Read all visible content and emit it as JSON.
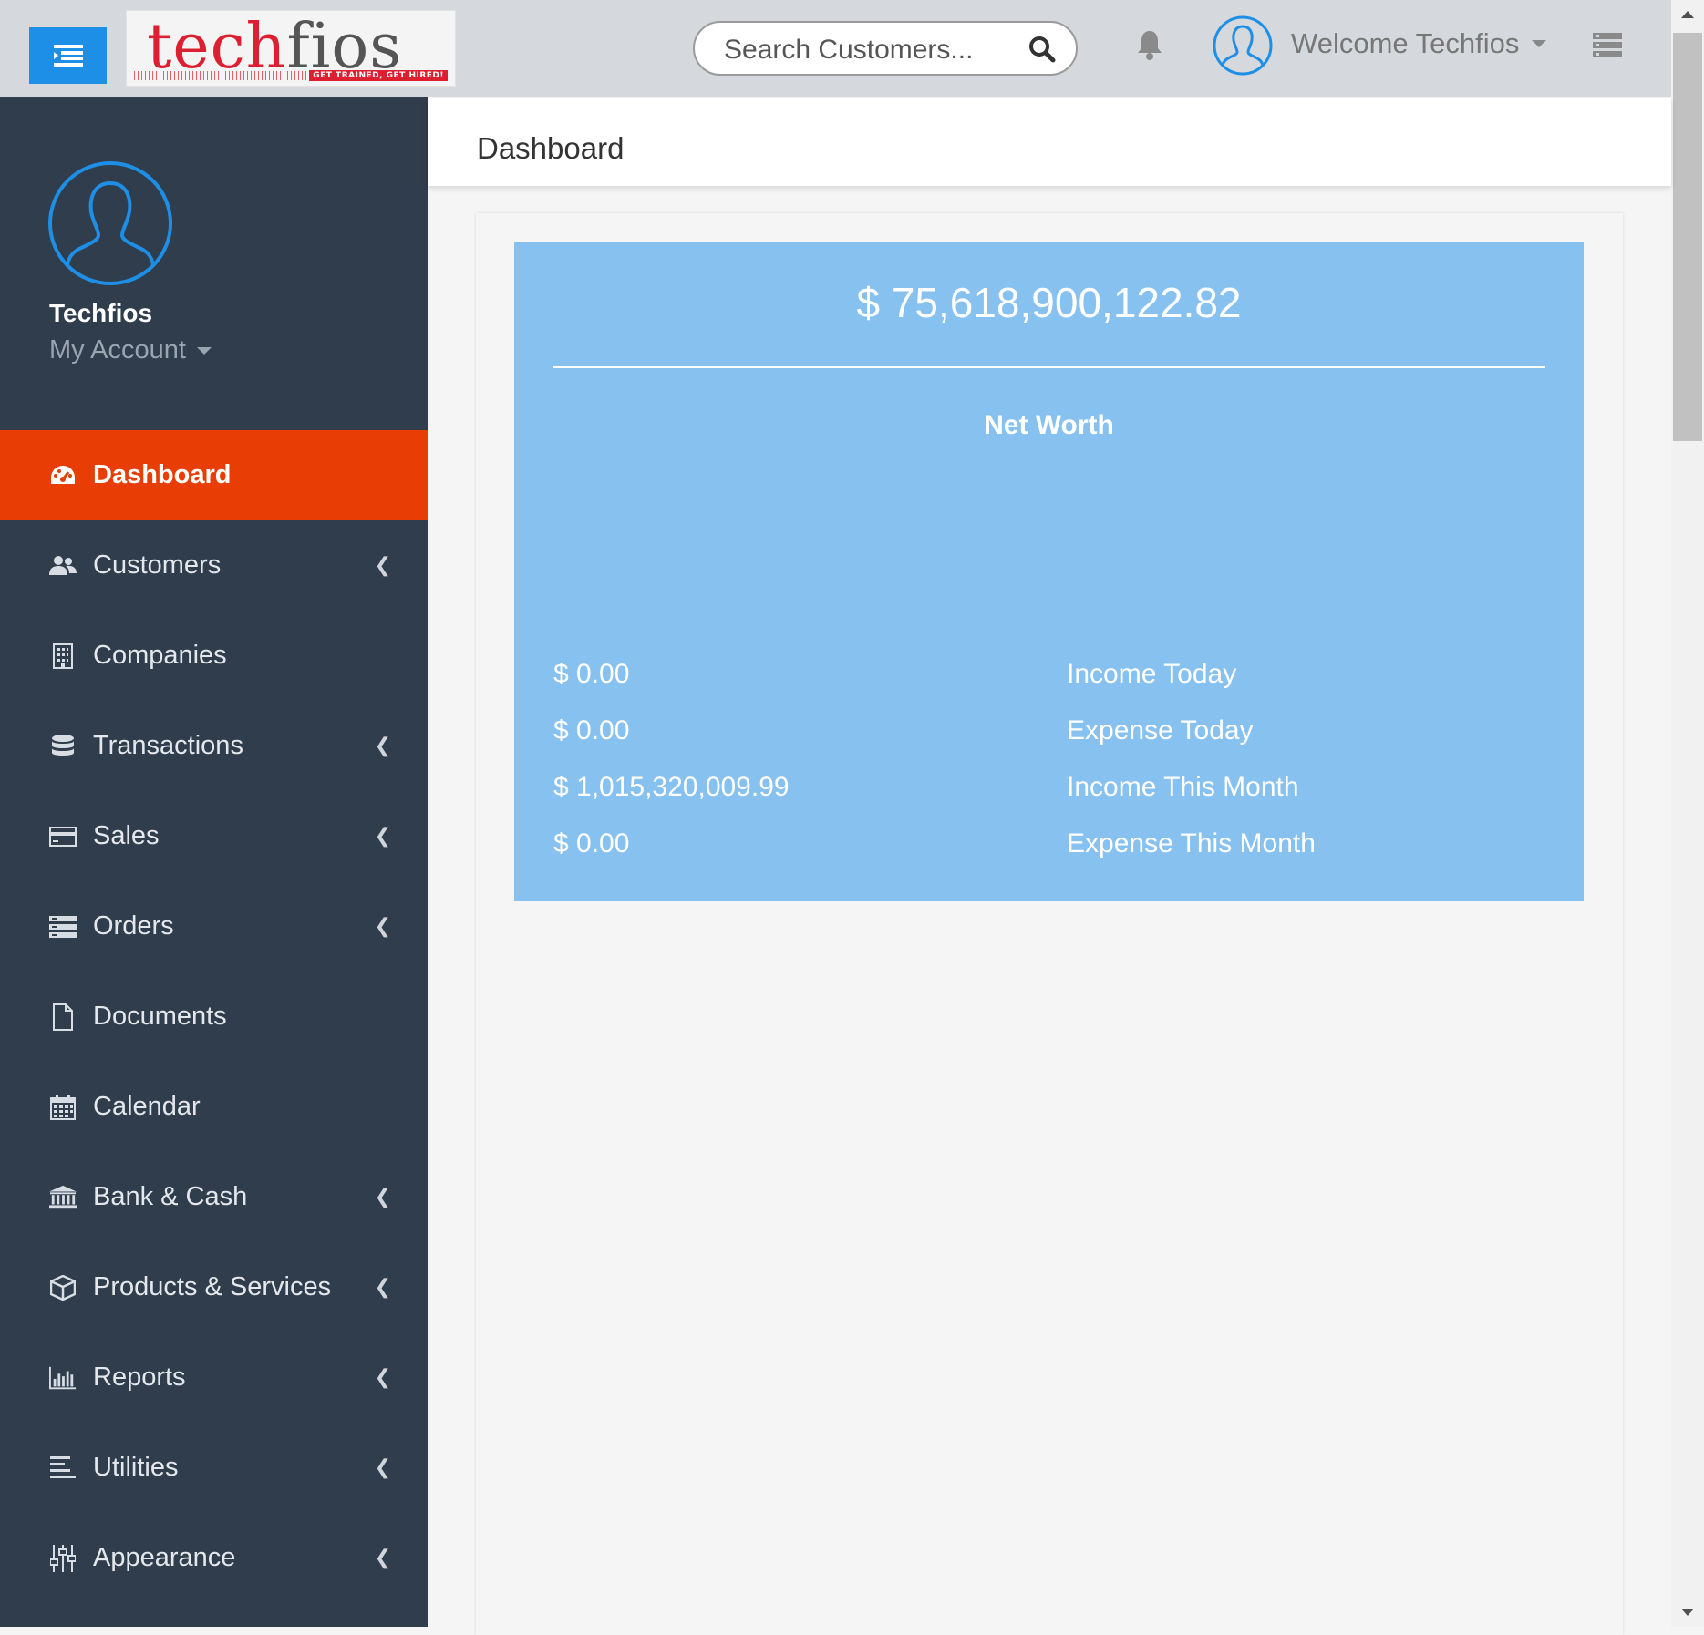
{
  "header": {
    "logo_text_red": "tech",
    "logo_text_dark": "fios",
    "logo_tagline": "GET TRAINED, GET HIRED!",
    "search_placeholder": "Search Customers...",
    "welcome": "Welcome Techfios"
  },
  "sidebar": {
    "user_name": "Techfios",
    "account_label": "My Account",
    "items": [
      {
        "label": "Dashboard",
        "icon": "dashboard-icon",
        "active": true
      },
      {
        "label": "Customers",
        "icon": "users-icon",
        "submenu": true
      },
      {
        "label": "Companies",
        "icon": "building-icon"
      },
      {
        "label": "Transactions",
        "icon": "database-icon",
        "submenu": true
      },
      {
        "label": "Sales",
        "icon": "credit-card-icon",
        "submenu": true
      },
      {
        "label": "Orders",
        "icon": "server-icon",
        "submenu": true
      },
      {
        "label": "Documents",
        "icon": "file-icon"
      },
      {
        "label": "Calendar",
        "icon": "calendar-icon"
      },
      {
        "label": "Bank & Cash",
        "icon": "bank-icon",
        "submenu": true
      },
      {
        "label": "Products & Services",
        "icon": "cube-icon",
        "submenu": true
      },
      {
        "label": "Reports",
        "icon": "bar-chart-icon",
        "submenu": true
      },
      {
        "label": "Utilities",
        "icon": "align-left-icon",
        "submenu": true
      },
      {
        "label": "Appearance",
        "icon": "sliders-icon",
        "submenu": true
      }
    ]
  },
  "main": {
    "page_title": "Dashboard",
    "net_worth_amount": "$ 75,618,900,122.82",
    "net_worth_label": "Net Worth",
    "stats": [
      {
        "value": "$ 0.00",
        "label": "Income Today"
      },
      {
        "value": "$ 0.00",
        "label": "Expense Today"
      },
      {
        "value": "$ 1,015,320,009.99",
        "label": "Income This Month"
      },
      {
        "value": "$ 0.00",
        "label": "Expense This Month"
      }
    ]
  },
  "colors": {
    "topbar": "#d5d8dc",
    "sidebar": "#2f3d4c",
    "active_nav": "#e83e06",
    "hamburger": "#1e8fe6",
    "networth_panel": "#86c1f0",
    "brand_red": "#dc1f31"
  }
}
